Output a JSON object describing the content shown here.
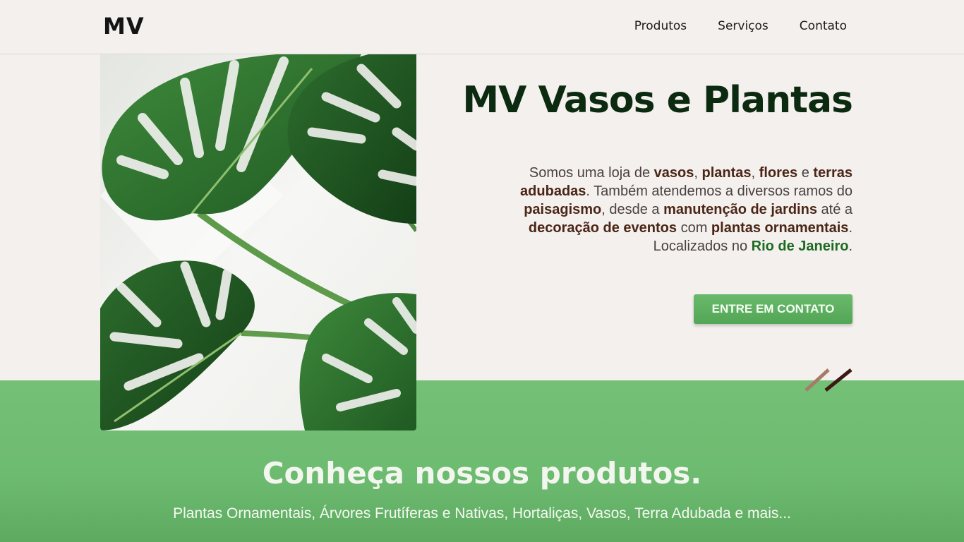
{
  "header": {
    "logo": "MV",
    "nav": [
      "Produtos",
      "Serviços",
      "Contato"
    ]
  },
  "hero": {
    "title": "MV Vasos e Plantas",
    "description_parts": [
      {
        "text": "Somos uma loja de ",
        "bold": false
      },
      {
        "text": "vasos",
        "bold": true
      },
      {
        "text": ", ",
        "bold": false
      },
      {
        "text": "plantas",
        "bold": true
      },
      {
        "text": ", ",
        "bold": false
      },
      {
        "text": "flores",
        "bold": true
      },
      {
        "text": " e ",
        "bold": false
      },
      {
        "text": "terras adubadas",
        "bold": true
      },
      {
        "text": ". Também atendemos a diversos ramos do ",
        "bold": false
      },
      {
        "text": "paisagismo",
        "bold": true
      },
      {
        "text": ", desde a ",
        "bold": false
      },
      {
        "text": "manutenção de jardins",
        "bold": true
      },
      {
        "text": " até a ",
        "bold": false
      },
      {
        "text": "decoração de eventos",
        "bold": true
      },
      {
        "text": " com ",
        "bold": false
      },
      {
        "text": "plantas ornamentais",
        "bold": true
      },
      {
        "text": ". Localizados no ",
        "bold": false
      },
      {
        "text": "Rio de Janeiro",
        "bold": true,
        "green": true
      },
      {
        "text": ".",
        "bold": false
      }
    ],
    "cta_label": "ENTRE EM CONTATO",
    "image_icon": "monstera-leaves-photo"
  },
  "products": {
    "title": "Conheça nossos produtos.",
    "subtitle": "Plantas Ornamentais, Árvores Frutíferas e Nativas, Hortaliças, Vasos, Terra Adubada e mais..."
  },
  "colors": {
    "background": "#f3f0ed",
    "green_band": "#6dbb70",
    "title": "#0b2a10",
    "bold_text": "#4b2617",
    "accent_green": "#1d6a22",
    "button": "#5bad5e"
  }
}
